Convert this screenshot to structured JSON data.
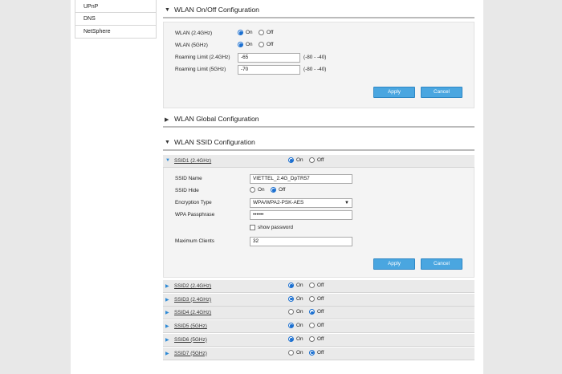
{
  "sidebar": {
    "items": [
      "UPnP",
      "DNS",
      "NetSphere"
    ]
  },
  "wlan_onoff": {
    "title": "WLAN On/Off Configuration",
    "on": "On",
    "off": "Off",
    "rows": {
      "wlan24": {
        "label": "WLAN (2.4GHz)",
        "selected": "on"
      },
      "wlan5": {
        "label": "WLAN (5GHz)",
        "selected": "on"
      },
      "roam24": {
        "label": "Roaming Limit (2.4GHz)",
        "value": "-65",
        "hint": "(-80 - -40)"
      },
      "roam5": {
        "label": "Roaming Limit (5GHz)",
        "value": "-70",
        "hint": "(-80 - -40)"
      }
    },
    "apply": "Apply",
    "cancel": "Cancel"
  },
  "wlan_global": {
    "title": "WLAN Global Configuration"
  },
  "wlan_ssid": {
    "title": "WLAN SSID Configuration",
    "on": "On",
    "off": "Off",
    "ssid1": {
      "name": "SSID1 (2.4GHz)",
      "selected": "on",
      "ssid_name_label": "SSID Name",
      "ssid_name_value": "VIETTEL_2.4G_DpTR57",
      "hide_label": "SSID Hide",
      "hide_selected": "off",
      "enc_label": "Encryption Type",
      "enc_value": "WPA/WPA2-PSK-AES",
      "pass_label": "WPA Passphrase",
      "pass_value": "••••••",
      "show_password": "show password",
      "max_label": "Maximum Clients",
      "max_value": "32",
      "apply": "Apply",
      "cancel": "Cancel"
    },
    "others": [
      {
        "name": "SSID2 (2.4GHz)",
        "selected": "on"
      },
      {
        "name": "SSID3 (2.4GHz)",
        "selected": "on"
      },
      {
        "name": "SSID4 (2.4GHz)",
        "selected": "off"
      },
      {
        "name": "SSID5 (5GHz)",
        "selected": "on"
      },
      {
        "name": "SSID6 (5GHz)",
        "selected": "on"
      },
      {
        "name": "SSID7 (5GHz)",
        "selected": "off"
      }
    ]
  }
}
